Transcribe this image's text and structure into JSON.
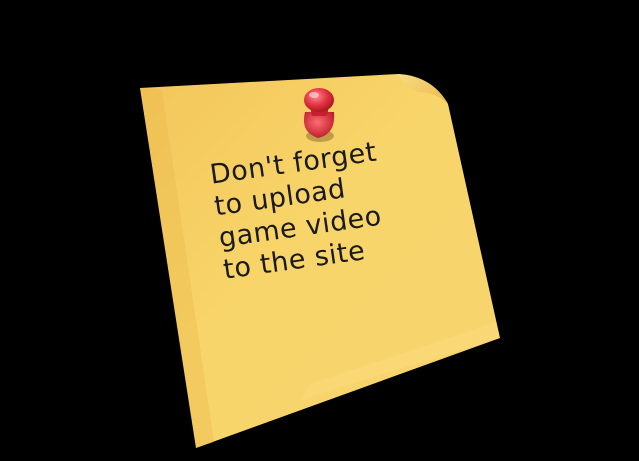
{
  "note": {
    "lines": [
      "Don't forget",
      "to upload",
      "game video",
      "to the site"
    ],
    "paper_color": "#f7d060",
    "pin_color": "#e0313f",
    "ink_color": "#1a1a1a",
    "background_color": "#000000"
  },
  "icons": {
    "pin": "push-pin-icon"
  }
}
